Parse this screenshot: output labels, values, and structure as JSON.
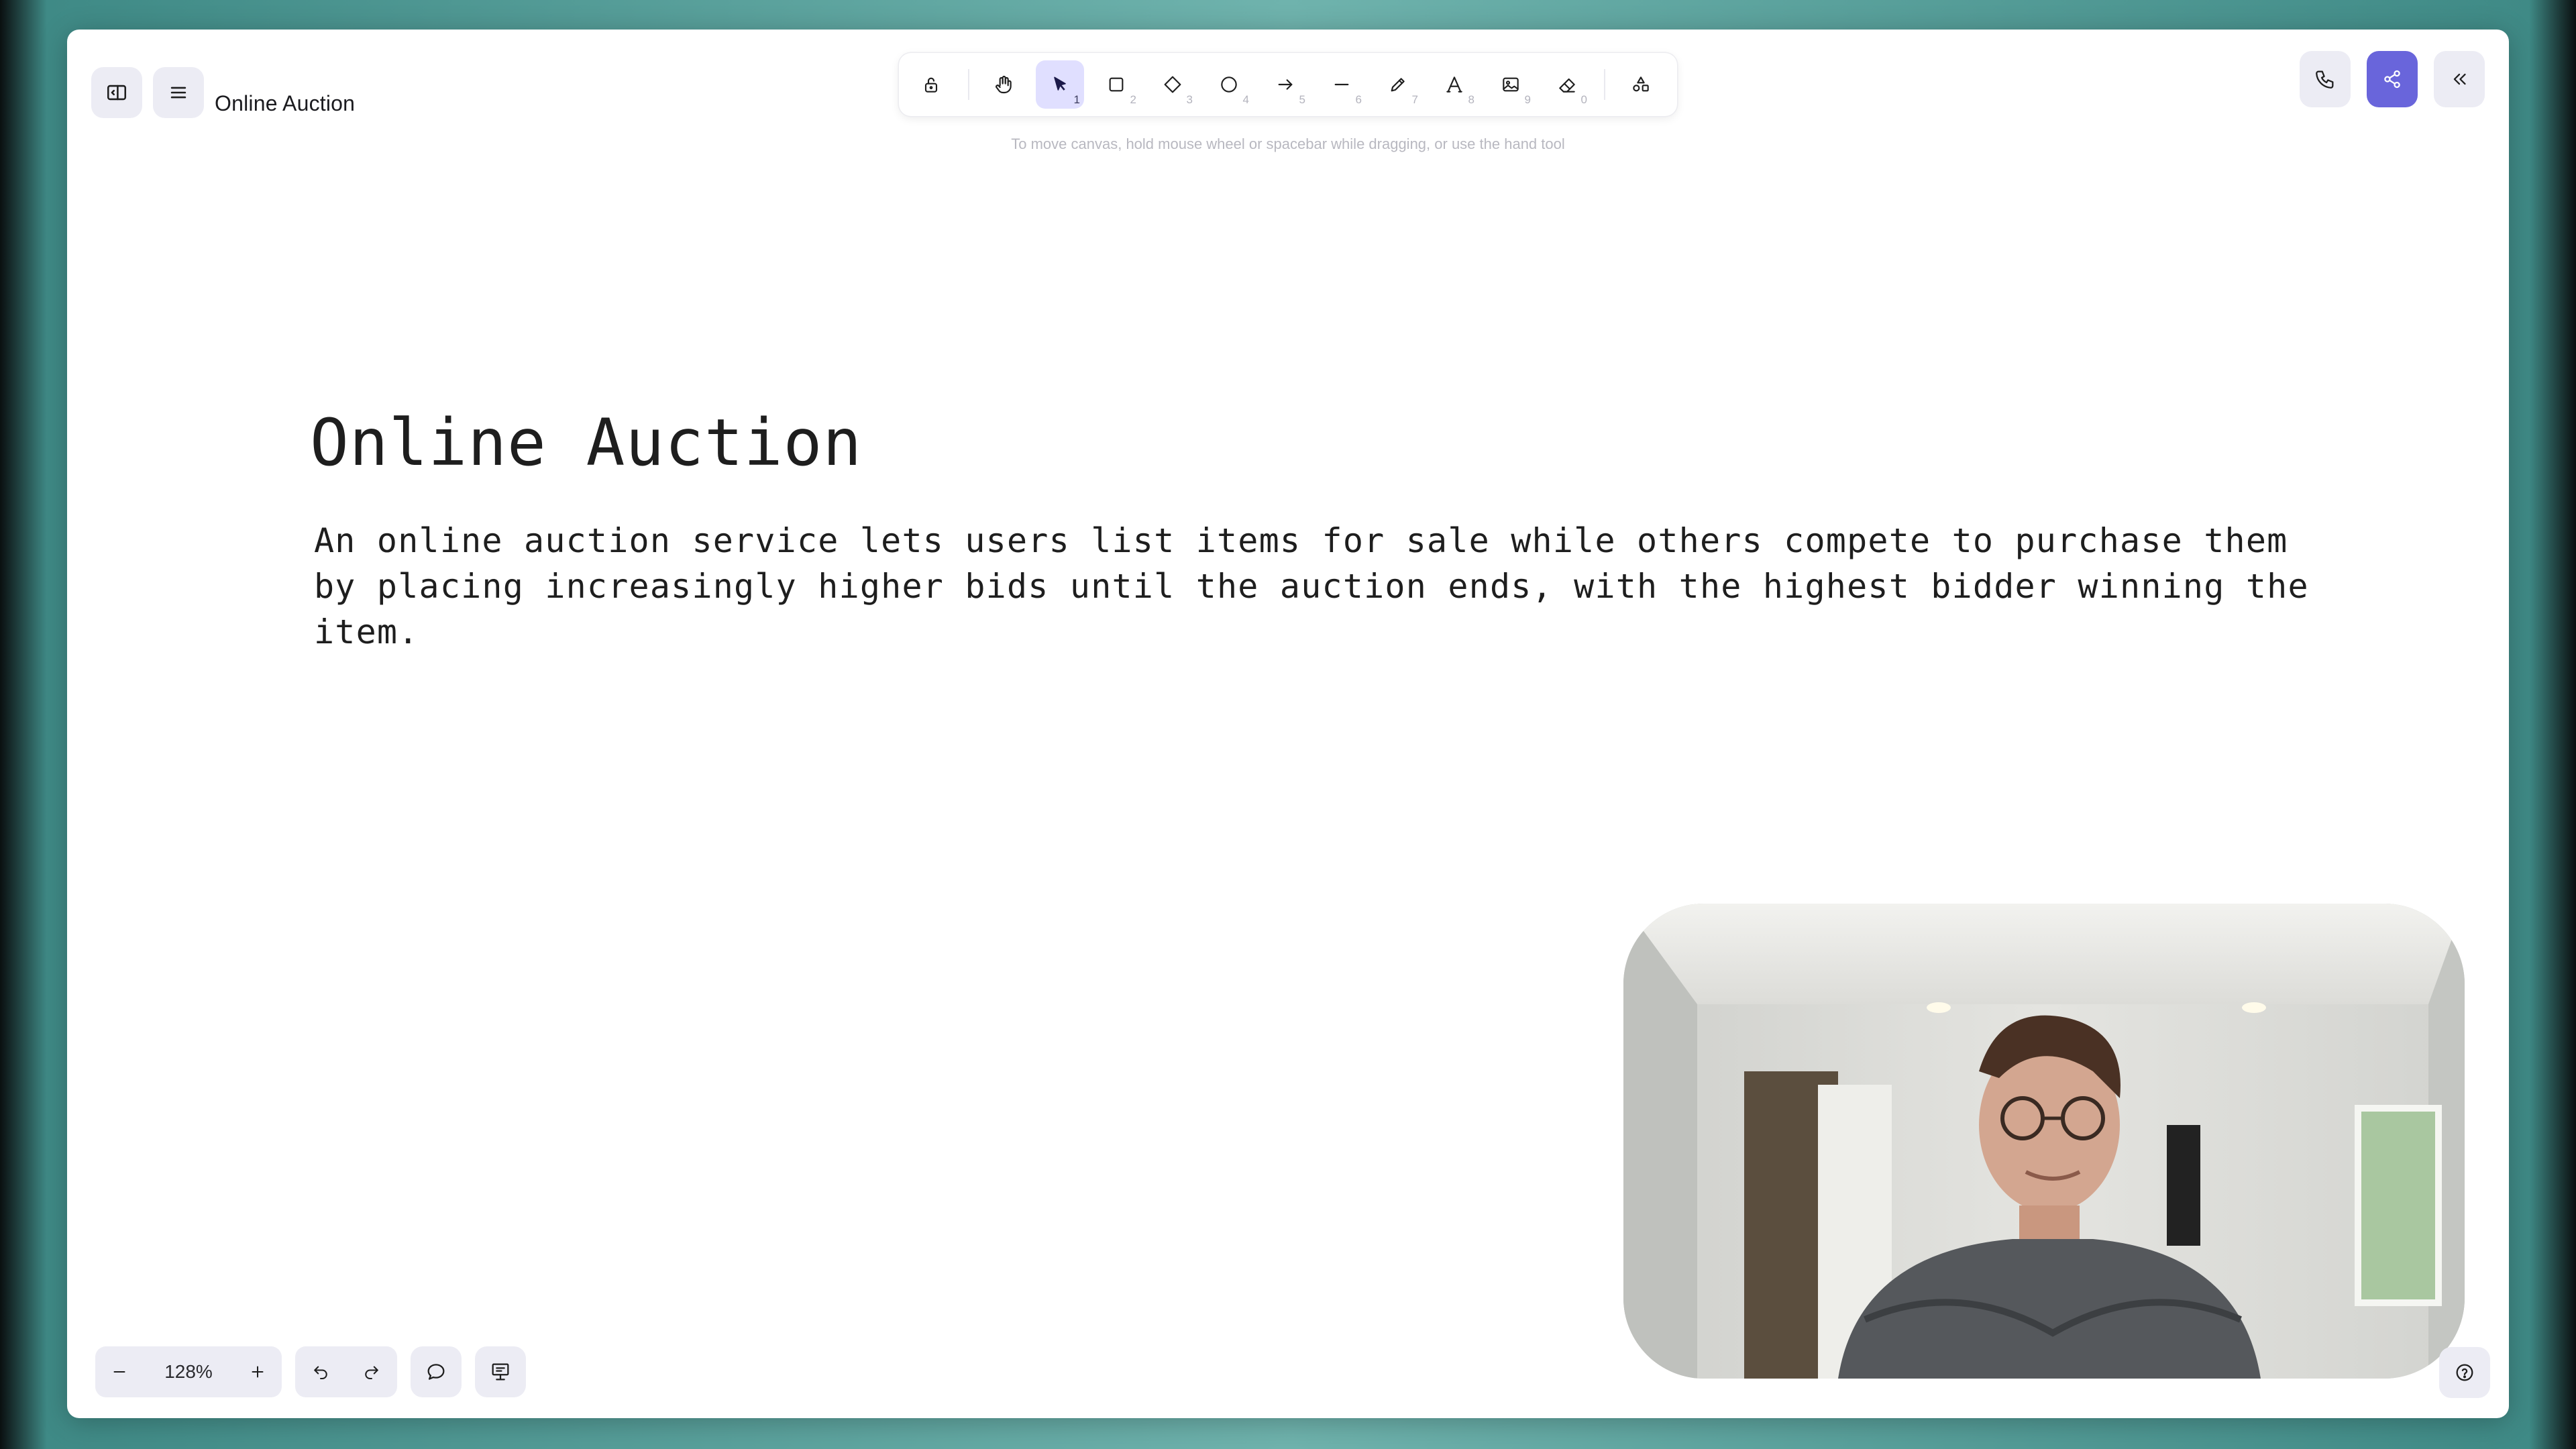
{
  "app": {
    "title": "Online Auction"
  },
  "top_left": {
    "sidebar_toggle_icon": "sidebar-icon",
    "menu_icon": "hamburger-menu-icon"
  },
  "toolbar": {
    "tools": [
      {
        "name": "lock",
        "icon": "lock-icon",
        "key": ""
      },
      {
        "name": "hand",
        "icon": "hand-icon",
        "key": ""
      },
      {
        "name": "selection",
        "icon": "pointer-icon",
        "key": "1"
      },
      {
        "name": "rectangle",
        "icon": "square-icon",
        "key": "2"
      },
      {
        "name": "diamond",
        "icon": "diamond-icon",
        "key": "3"
      },
      {
        "name": "ellipse",
        "icon": "circle-icon",
        "key": "4"
      },
      {
        "name": "arrow",
        "icon": "arrow-right-icon",
        "key": "5"
      },
      {
        "name": "line",
        "icon": "line-icon",
        "key": "6"
      },
      {
        "name": "draw",
        "icon": "pencil-icon",
        "key": "7"
      },
      {
        "name": "text",
        "icon": "text-icon",
        "key": "8"
      },
      {
        "name": "image",
        "icon": "image-icon",
        "key": "9"
      },
      {
        "name": "eraser",
        "icon": "eraser-icon",
        "key": "0"
      },
      {
        "name": "more-shapes",
        "icon": "shapes-icon",
        "key": ""
      }
    ],
    "active_tool": "selection"
  },
  "top_right": {
    "call_icon": "phone-icon",
    "share_icon": "share-icon",
    "collapse_icon": "chevrons-left-icon",
    "accent_color": "#6965db"
  },
  "canvas": {
    "hint": "To move canvas, hold mouse wheel or spacebar while dragging, or use the hand tool",
    "heading": "Online Auction",
    "description": "An online auction service lets users list items for sale while others compete to purchase them by placing increasingly higher bids until the auction ends, with the highest bidder winning the item."
  },
  "footer": {
    "zoom_level": "128%",
    "zoom_out_icon": "minus-icon",
    "zoom_in_icon": "plus-icon",
    "undo_icon": "undo-icon",
    "redo_icon": "redo-icon",
    "comment_icon": "comment-icon",
    "presentation_icon": "presentation-icon",
    "help_icon": "help-icon"
  },
  "video": {
    "description_icon": "webcam-feed"
  }
}
